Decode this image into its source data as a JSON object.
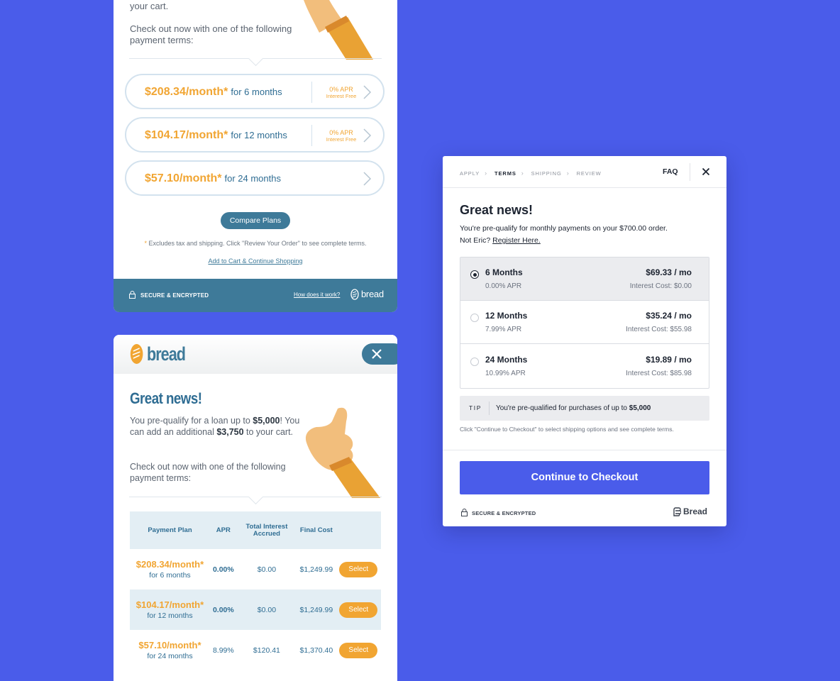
{
  "colors": {
    "background": "#4a5cea",
    "bread_blue": "#3e7a99",
    "accent_orange": "#f1a532",
    "cta_blue": "#4a5cea"
  },
  "card_pills": {
    "intro_line": "your cart.",
    "intro_checkout": "Check out now with one of the following payment terms:",
    "plans": [
      {
        "amount": "$208.34/month*",
        "duration": "for 6 months",
        "apr": "0% APR",
        "apr_note": "Interest Free"
      },
      {
        "amount": "$104.17/month*",
        "duration": "for 12 months",
        "apr": "0% APR",
        "apr_note": "Interest Free"
      },
      {
        "amount": "$57.10/month*",
        "duration": "for 24 months",
        "apr": "",
        "apr_note": ""
      }
    ],
    "compare_label": "Compare Plans",
    "fine_print_star": "*",
    "fine_print": "Excludes tax and shipping. Click \"Review Your Order\" to see complete terms.",
    "add_to_cart_link": "Add to Cart & Continue Shopping",
    "footer": {
      "secure": "SECURE & ENCRYPTED",
      "how_link": "How does it work?",
      "logo": "bread"
    }
  },
  "card_table": {
    "brand": "bread",
    "title": "Great news!",
    "intro": {
      "t1": "You pre-qualify for a loan up to ",
      "amount1": "$5,000",
      "t2": "! You can add an additional ",
      "amount2": "$3,750",
      "t3": " to your cart.",
      "checkout": "Check out now with one of the following payment terms:"
    },
    "headers": [
      "Payment Plan",
      "APR",
      "Total Interest Accrued",
      "Final Cost",
      ""
    ],
    "rows": [
      {
        "amount": "$208.34/month*",
        "duration": "for 6 months",
        "apr": "0.00%",
        "interest": "$0.00",
        "final": "$1,249.99",
        "action": "Select"
      },
      {
        "amount": "$104.17/month*",
        "duration": "for 12 months",
        "apr": "0.00%",
        "interest": "$0.00",
        "final": "$1,249.99",
        "action": "Select"
      },
      {
        "amount": "$57.10/month*",
        "duration": "for 24 months",
        "apr": "8.99%",
        "interest": "$120.41",
        "final": "$1,370.40",
        "action": "Select"
      }
    ]
  },
  "modal": {
    "breadcrumbs": [
      {
        "label": "APPLY",
        "active": false
      },
      {
        "label": "TERMS",
        "active": true
      },
      {
        "label": "SHIPPING",
        "active": false
      },
      {
        "label": "REVIEW",
        "active": false
      }
    ],
    "faq": "FAQ",
    "title": "Great news!",
    "subtitle": "You're pre-qualify for monthly payments on your $700.00 order.",
    "not_user": "Not Eric?",
    "register_link": "Register Here.",
    "options": [
      {
        "name": "6 Months",
        "apr": "0.00% APR",
        "price": "$69.33 / mo",
        "interest": "Interest Cost: $0.00",
        "selected": true
      },
      {
        "name": "12 Months",
        "apr": "7.99% APR",
        "price": "$35.24 / mo",
        "interest": "Interest Cost: $55.98",
        "selected": false
      },
      {
        "name": "24 Months",
        "apr": "10.99% APR",
        "price": "$19.89 / mo",
        "interest": "Interest Cost: $85.98",
        "selected": false
      }
    ],
    "tip_label": "TIP",
    "tip_text": "You're pre-qualified for purchases of up to ",
    "tip_amount": "$5,000",
    "fine_print": "Click \"Continue to Checkout\" to select shipping options and see complete terms.",
    "cta": "Continue to Checkout",
    "secure": "SECURE & ENCRYPTED",
    "logo": "Bread"
  }
}
